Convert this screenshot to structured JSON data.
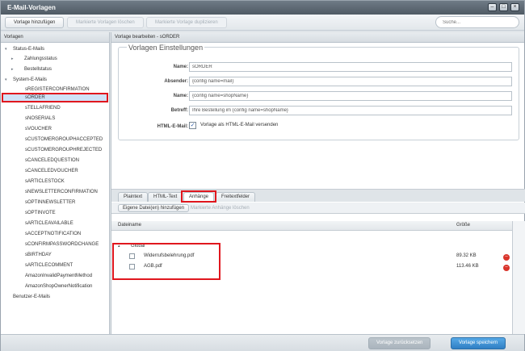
{
  "window": {
    "title": "E-Mail-Vorlagen",
    "buttons": [
      "–",
      "□",
      "×"
    ]
  },
  "toolbar": {
    "add_template": "Vorlage hinzufügen",
    "delete_selected": "Markierte Vorlagen löschen",
    "duplicate_selected": "Markierte Vorlage duplizieren",
    "search_placeholder": "Suche..."
  },
  "left_panel": {
    "header": "Vorlagen",
    "items": [
      {
        "label": "Status-E-Mails",
        "level": 0,
        "arrow": "▾"
      },
      {
        "label": "Zahlungsstatus",
        "level": 1,
        "arrow": "▸"
      },
      {
        "label": "Bestellstatus",
        "level": 1,
        "arrow": "▸"
      },
      {
        "label": "System-E-Mails",
        "level": 0,
        "arrow": "▾"
      },
      {
        "label": "sREGISTERCONFIRMATION",
        "level": 2
      },
      {
        "label": "sORDER",
        "level": 2,
        "selected": true
      },
      {
        "label": "sTELLAFRIEND",
        "level": 2
      },
      {
        "label": "sNOSERIALS",
        "level": 2
      },
      {
        "label": "sVOUCHER",
        "level": 2
      },
      {
        "label": "sCUSTOMERGROUPHACCEPTED",
        "level": 2
      },
      {
        "label": "sCUSTOMERGROUPHREJECTED",
        "level": 2
      },
      {
        "label": "sCANCELEDQUESTION",
        "level": 2
      },
      {
        "label": "sCANCELEDVOUCHER",
        "level": 2
      },
      {
        "label": "sARTICLESTOCK",
        "level": 2
      },
      {
        "label": "sNEWSLETTERCONFIRMATION",
        "level": 2
      },
      {
        "label": "sOPTINNEWSLETTER",
        "level": 2
      },
      {
        "label": "sOPTINVOTE",
        "level": 2
      },
      {
        "label": "sARTICLEAVAILABLE",
        "level": 2
      },
      {
        "label": "sACCEPTNOTIFICATION",
        "level": 2
      },
      {
        "label": "sCONFIRMPASSWORDCHANGE",
        "level": 2
      },
      {
        "label": "sBIRTHDAY",
        "level": 2
      },
      {
        "label": "sARTICLECOMMENT",
        "level": 2
      },
      {
        "label": "AmazonInvalidPaymentMethod",
        "level": 2
      },
      {
        "label": "AmazonShopOwnerNotification",
        "level": 2
      },
      {
        "label": "Benutzer-E-Mails",
        "level": 0
      }
    ]
  },
  "editor": {
    "header": "Vorlage bearbeiten - sORDER",
    "fieldset_title": "Vorlagen Einstellungen",
    "fields": {
      "name_label": "Name:",
      "name_value": "sORDER",
      "sender_label": "Absender:",
      "sender_value": "{config name=mail}",
      "name2_label": "Name:",
      "name2_value": "{config name=shopName}",
      "subject_label": "Betreff:",
      "subject_value": "Ihre Bestellung im {config name=shopName}",
      "html_label": "HTML-E-Mail:",
      "html_checkbox_text": "Vorlage als HTML-E-Mail versenden",
      "html_checked": "✓"
    },
    "tabs": [
      "Plaintext",
      "HTML-Text",
      "Anhänge",
      "Freitextfelder"
    ],
    "subtoolbar": {
      "add_files": "Eigene Datei(en) hinzufügen",
      "delete_attachments": "Markierte Anhänge löschen"
    },
    "grid": {
      "col_name": "Dateiname",
      "col_size": "Größe",
      "group": "Global",
      "group_arrow": "▴",
      "rows": [
        {
          "name": "Widerrufsbelehrung.pdf",
          "size": "89.32 KB"
        },
        {
          "name": "AGB.pdf",
          "size": "113.46 KB"
        }
      ],
      "delete_glyph": "–"
    }
  },
  "footer": {
    "reset": "Vorlage zurücksetzen",
    "save": "Vorlage speichern"
  },
  "colors": {
    "highlight": "#e0171e",
    "primary": "#2f7fc4"
  }
}
